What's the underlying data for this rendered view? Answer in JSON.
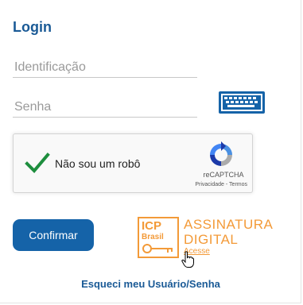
{
  "login": {
    "title": "Login",
    "identification_placeholder": "Identificação",
    "password_placeholder": "Senha",
    "keyboard_icon": "virtual-keyboard-icon",
    "confirm_label": "Confirmar",
    "forgot_label": "Esqueci meu Usuário/Senha"
  },
  "captcha": {
    "label": "Não sou um robô",
    "brand": "reCAPTCHA",
    "privacy": "Privacidade",
    "separator": " - ",
    "terms": "Termos",
    "checked": true,
    "check_color": "#1e8e3e"
  },
  "signature": {
    "logo_text_top": "ICP",
    "logo_text_bottom": "Brasil",
    "line1": "ASSINATURA",
    "line2": "DIGITAL",
    "link": "Acesse",
    "accent_color": "#f39a38"
  },
  "colors": {
    "primary": "#1563a8",
    "title": "#1a5a96"
  }
}
